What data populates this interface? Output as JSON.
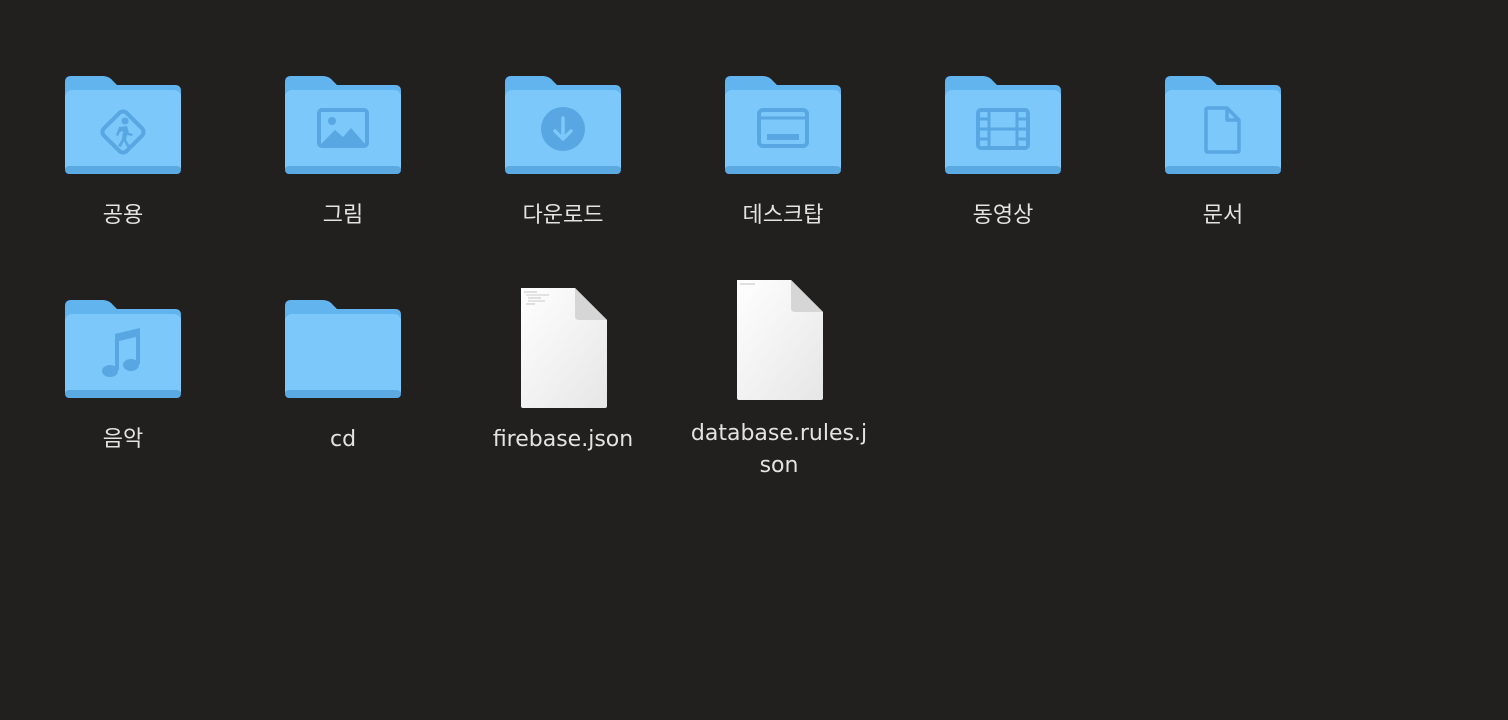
{
  "finder": {
    "items": [
      {
        "label": "공용",
        "kind": "folder",
        "glyph": "accessibility-icon"
      },
      {
        "label": "그림",
        "kind": "folder",
        "glyph": "picture-icon"
      },
      {
        "label": "다운로드",
        "kind": "folder",
        "glyph": "download-icon"
      },
      {
        "label": "데스크탑",
        "kind": "folder",
        "glyph": "desktop-icon"
      },
      {
        "label": "동영상",
        "kind": "folder",
        "glyph": "film-icon"
      },
      {
        "label": "문서",
        "kind": "folder",
        "glyph": "document-icon"
      },
      {
        "label": "음악",
        "kind": "folder",
        "glyph": "music-note-icon"
      },
      {
        "label": "cd",
        "kind": "folder",
        "glyph": ""
      },
      {
        "label": "firebase.json",
        "kind": "file",
        "glyph": "json-file-icon"
      },
      {
        "label": "database.rules.json",
        "kind": "file",
        "glyph": "json-file-icon"
      }
    ]
  },
  "colors": {
    "background": "#21201e",
    "folder_back": "#62b4ee",
    "folder_front": "#7cc8fb",
    "folder_glyph": "#58a6e2",
    "label_text": "#e3e3e3"
  }
}
